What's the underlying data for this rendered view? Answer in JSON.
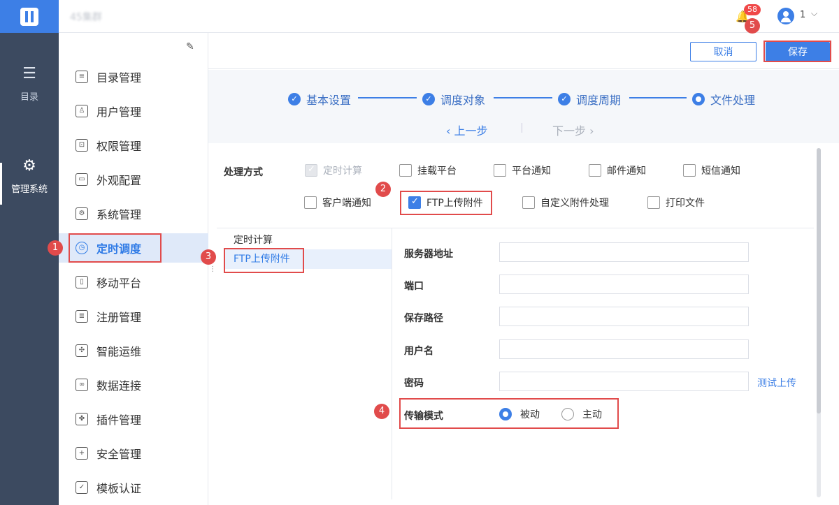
{
  "rail": {
    "items": [
      {
        "label": "目录",
        "icon": "list-icon"
      },
      {
        "label": "管理系统",
        "icon": "gear-icon"
      }
    ]
  },
  "topbar": {
    "brand": "45集群",
    "notifications": "58",
    "user": "1"
  },
  "nav": {
    "items": [
      {
        "label": "目录管理",
        "icon": "catalog-icon"
      },
      {
        "label": "用户管理",
        "icon": "user-icon"
      },
      {
        "label": "权限管理",
        "icon": "lock-icon"
      },
      {
        "label": "外观配置",
        "icon": "brush-icon"
      },
      {
        "label": "系统管理",
        "icon": "gear-icon"
      },
      {
        "label": "定时调度",
        "icon": "timer-icon"
      },
      {
        "label": "移动平台",
        "icon": "tablet-icon"
      },
      {
        "label": "注册管理",
        "icon": "register-icon"
      },
      {
        "label": "智能运维",
        "icon": "network-icon"
      },
      {
        "label": "数据连接",
        "icon": "link-icon"
      },
      {
        "label": "插件管理",
        "icon": "puzzle-icon"
      },
      {
        "label": "安全管理",
        "icon": "shield-icon"
      },
      {
        "label": "模板认证",
        "icon": "template-icon"
      }
    ],
    "active": "定时调度"
  },
  "actions": {
    "cancel": "取消",
    "save": "保存"
  },
  "steps": {
    "items": [
      "基本设置",
      "调度对象",
      "调度周期",
      "文件处理"
    ],
    "prev": "上一步",
    "next": "下一步"
  },
  "processing": {
    "label": "处理方式",
    "options_row1": [
      "定时计算",
      "挂载平台",
      "平台通知",
      "邮件通知",
      "短信通知"
    ],
    "options_row2": [
      "客户端通知",
      "FTP上传附件",
      "自定义附件处理",
      "打印文件"
    ],
    "checked": "FTP上传附件",
    "disabled_checked": "定时计算"
  },
  "side_list": [
    "定时计算",
    "FTP上传附件"
  ],
  "form": {
    "server": "服务器地址",
    "port": "端口",
    "path": "保存路径",
    "username": "用户名",
    "password": "密码",
    "test_upload": "测试上传",
    "transfer_mode": "传输模式",
    "passive": "被动",
    "active": "主动"
  },
  "markers": [
    "1",
    "2",
    "3",
    "4",
    "5"
  ],
  "colors": {
    "accent": "#3d7fe6",
    "rail": "#3c4a60",
    "highlight": "#e14b4b"
  }
}
